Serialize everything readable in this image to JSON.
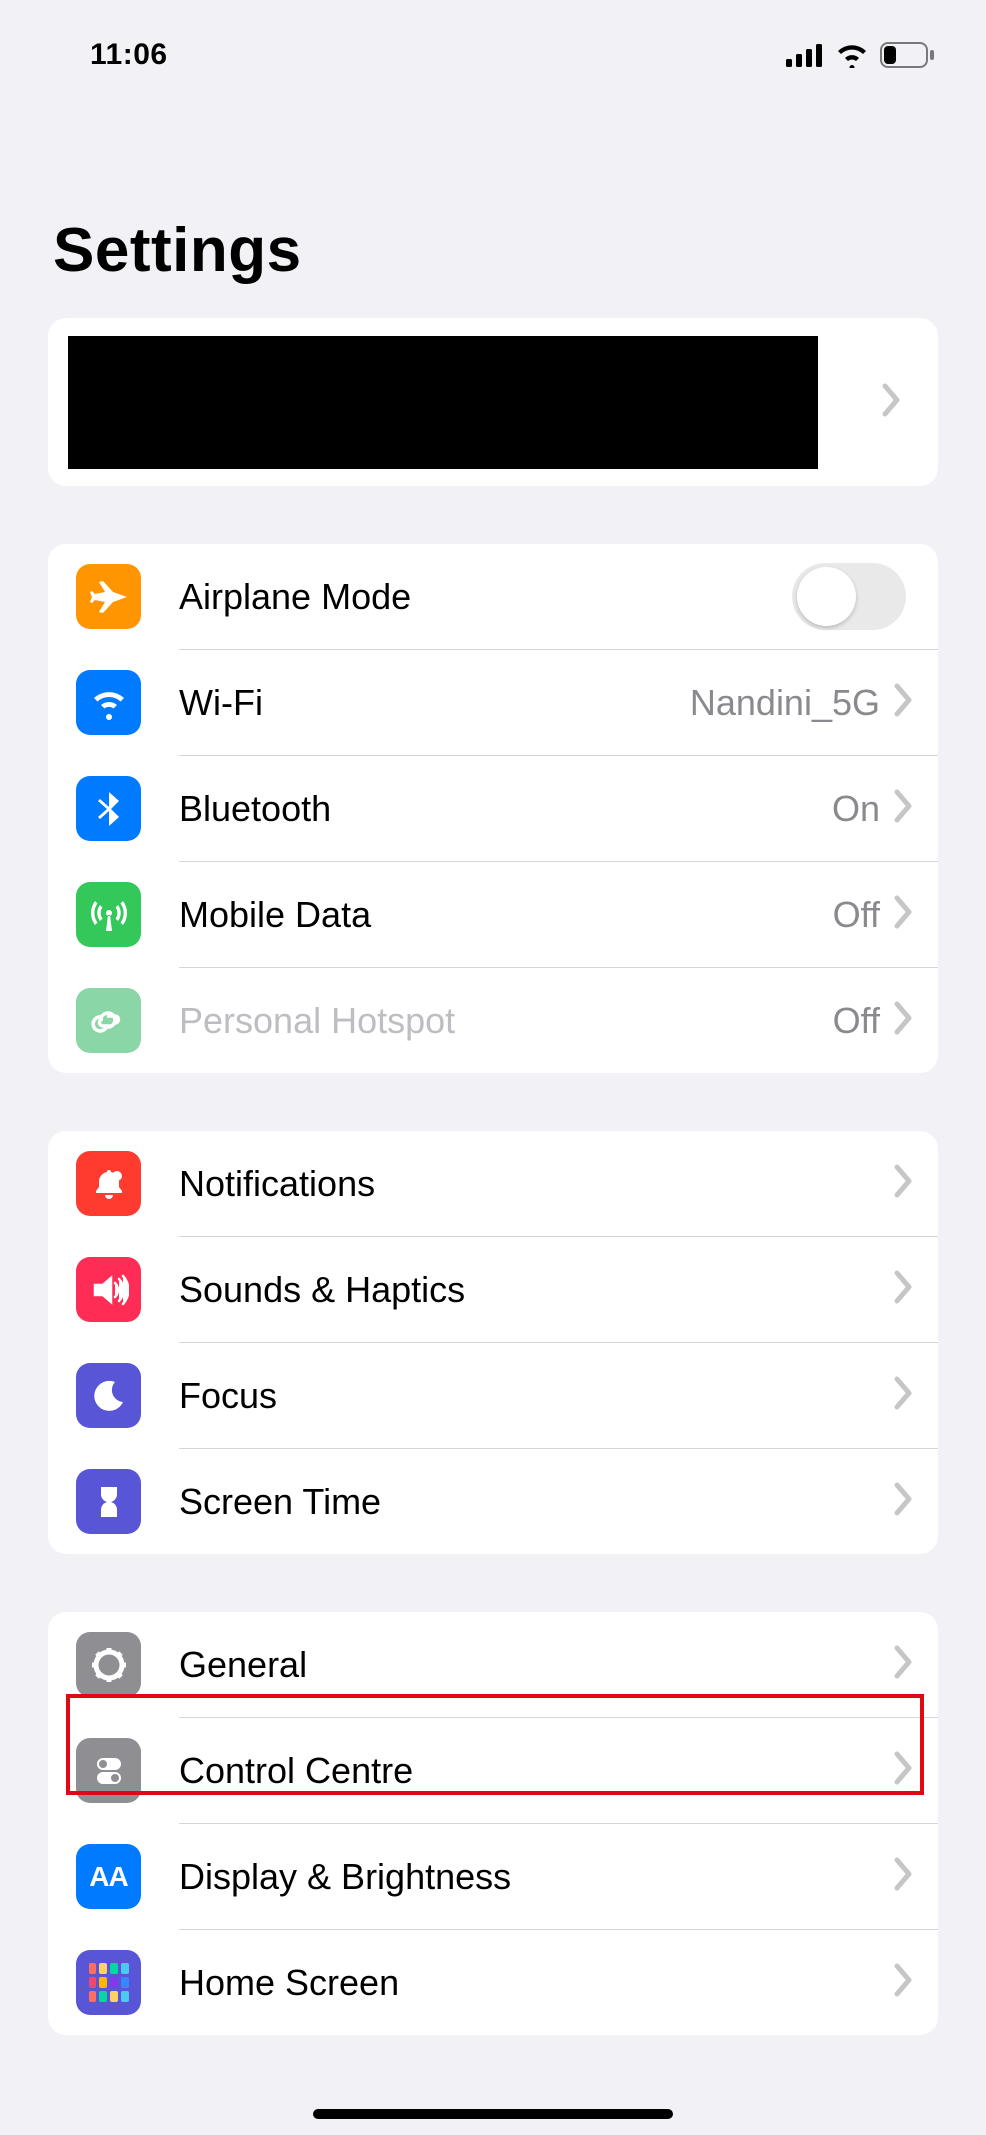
{
  "statusBar": {
    "time": "11:06"
  },
  "page": {
    "title": "Settings"
  },
  "groups": [
    {
      "id": "connectivity",
      "rows": [
        {
          "id": "airplane",
          "label": "Airplane Mode",
          "value": "",
          "control": "toggle",
          "toggle": false
        },
        {
          "id": "wifi",
          "label": "Wi-Fi",
          "value": "Nandini_5G",
          "control": "disclosure"
        },
        {
          "id": "bluetooth",
          "label": "Bluetooth",
          "value": "On",
          "control": "disclosure"
        },
        {
          "id": "mobiledata",
          "label": "Mobile Data",
          "value": "Off",
          "control": "disclosure"
        },
        {
          "id": "hotspot",
          "label": "Personal Hotspot",
          "value": "Off",
          "control": "disclosure",
          "dim": true
        }
      ]
    },
    {
      "id": "notifications",
      "rows": [
        {
          "id": "notifications",
          "label": "Notifications",
          "value": "",
          "control": "disclosure"
        },
        {
          "id": "sounds",
          "label": "Sounds & Haptics",
          "value": "",
          "control": "disclosure"
        },
        {
          "id": "focus",
          "label": "Focus",
          "value": "",
          "control": "disclosure"
        },
        {
          "id": "screentime",
          "label": "Screen Time",
          "value": "",
          "control": "disclosure"
        }
      ]
    },
    {
      "id": "general",
      "rows": [
        {
          "id": "general",
          "label": "General",
          "value": "",
          "control": "disclosure",
          "highlighted": true
        },
        {
          "id": "controlcentre",
          "label": "Control Centre",
          "value": "",
          "control": "disclosure"
        },
        {
          "id": "display",
          "label": "Display & Brightness",
          "value": "",
          "control": "disclosure"
        },
        {
          "id": "homescreen",
          "label": "Home Screen",
          "value": "",
          "control": "disclosure"
        }
      ]
    }
  ]
}
